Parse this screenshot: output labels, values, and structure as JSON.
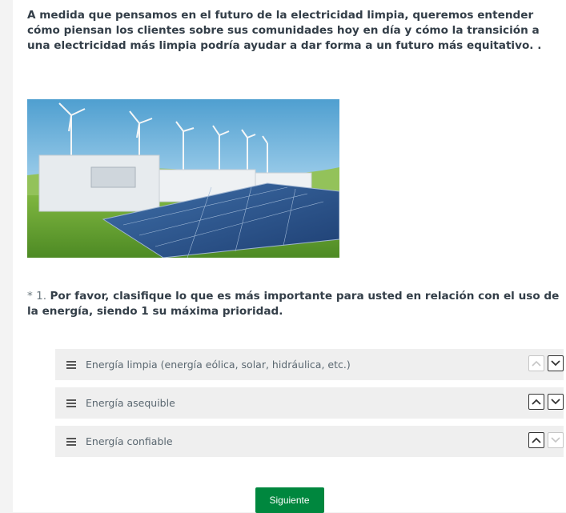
{
  "intro": {
    "text": "A medida que pensamos en el futuro de la electricidad limpia, queremos entender cómo piensan los clientes sobre sus comunidades hoy en día y cómo la transición a una electricidad más limpia podría ayudar a dar forma a un futuro más equitativo. ."
  },
  "question": {
    "required_mark": "* ",
    "number": "1.",
    "text": "Por favor, clasifique lo que es más importante para usted en relación con el uso de la energía, siendo 1 su máxima prioridad."
  },
  "ranking": {
    "items": [
      {
        "label": "Energía limpia (energía eólica, solar, hidráulica, etc.)"
      },
      {
        "label": "Energía asequible"
      },
      {
        "label": "Energía confiable"
      }
    ]
  },
  "navigation": {
    "next_label": "Siguiente"
  },
  "colors": {
    "next_button": "#00873e",
    "row_background": "#efefef"
  }
}
